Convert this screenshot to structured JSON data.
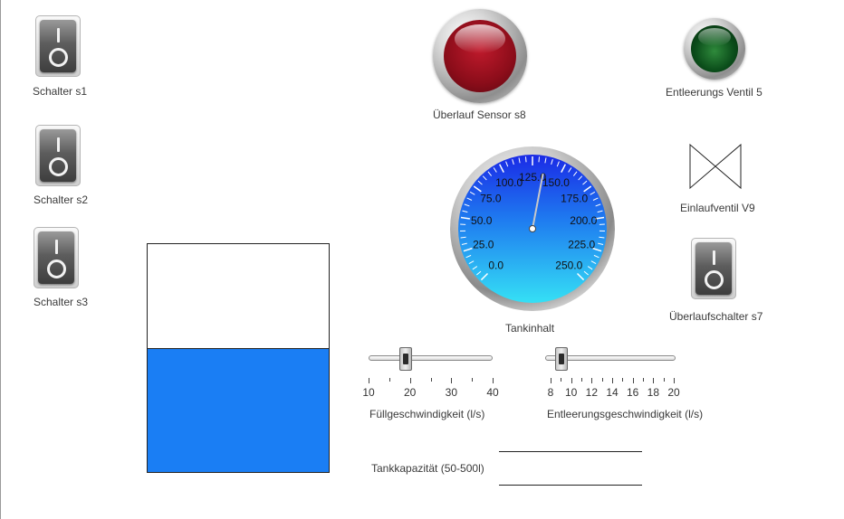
{
  "switches": {
    "s1": {
      "label": "Schalter s1"
    },
    "s2": {
      "label": "Schalter s2"
    },
    "s3": {
      "label": "Schalter s3"
    },
    "s7": {
      "label": "Überlaufschalter s7"
    }
  },
  "lamps": {
    "overflow_sensor": {
      "label": "Überlauf Sensor s8",
      "color": "#a01020",
      "state": "on"
    },
    "drain_valve": {
      "label": "Entleerungs Ventil 5",
      "color": "#0b4d1a",
      "state": "off"
    }
  },
  "inlet_valve": {
    "label": "Einlaufventil V9"
  },
  "gauge": {
    "label": "Tankinhalt",
    "min": 0,
    "max": 250,
    "value": 135,
    "ticks": [
      "0.0",
      "25.0",
      "50.0",
      "75.0",
      "100.0",
      "125.0",
      "150.0",
      "175.0",
      "200.0",
      "225.0",
      "250.0"
    ]
  },
  "tank": {
    "fill_fraction": 0.54,
    "fill_color": "#1a7ef4"
  },
  "fill_speed": {
    "label": "Füllgeschwindigkeit (l/s)",
    "min": 10,
    "max": 40,
    "value": 15,
    "tick_labels": [
      "10",
      "20",
      "30",
      "40"
    ]
  },
  "drain_speed": {
    "label": "Entleerungsgeschwindigkeit (l/s)",
    "min": 8,
    "max": 20,
    "value": 8,
    "tick_labels": [
      "8",
      "10",
      "12",
      "14",
      "16",
      "18",
      "20"
    ]
  },
  "capacity": {
    "label": "Tankkapazität (50-500l)",
    "value": ""
  }
}
